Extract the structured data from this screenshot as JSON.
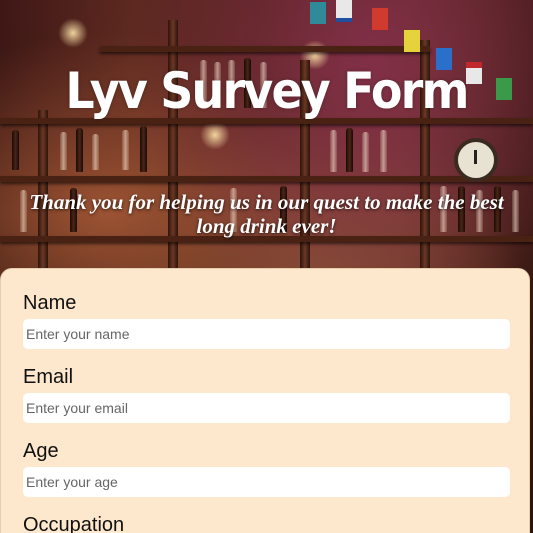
{
  "header": {
    "title": "Lyv Survey Form",
    "tagline": "Thank you for helping us in our quest to make the best long drink ever!"
  },
  "form": {
    "fields": [
      {
        "label": "Name",
        "placeholder": "Enter your name"
      },
      {
        "label": "Email",
        "placeholder": "Enter your email"
      },
      {
        "label": "Age",
        "placeholder": "Enter your age"
      },
      {
        "label": "Occupation"
      }
    ]
  },
  "colors": {
    "card_background": "#fde8cd",
    "input_background": "#ffffff",
    "title_text": "#ffffff"
  }
}
